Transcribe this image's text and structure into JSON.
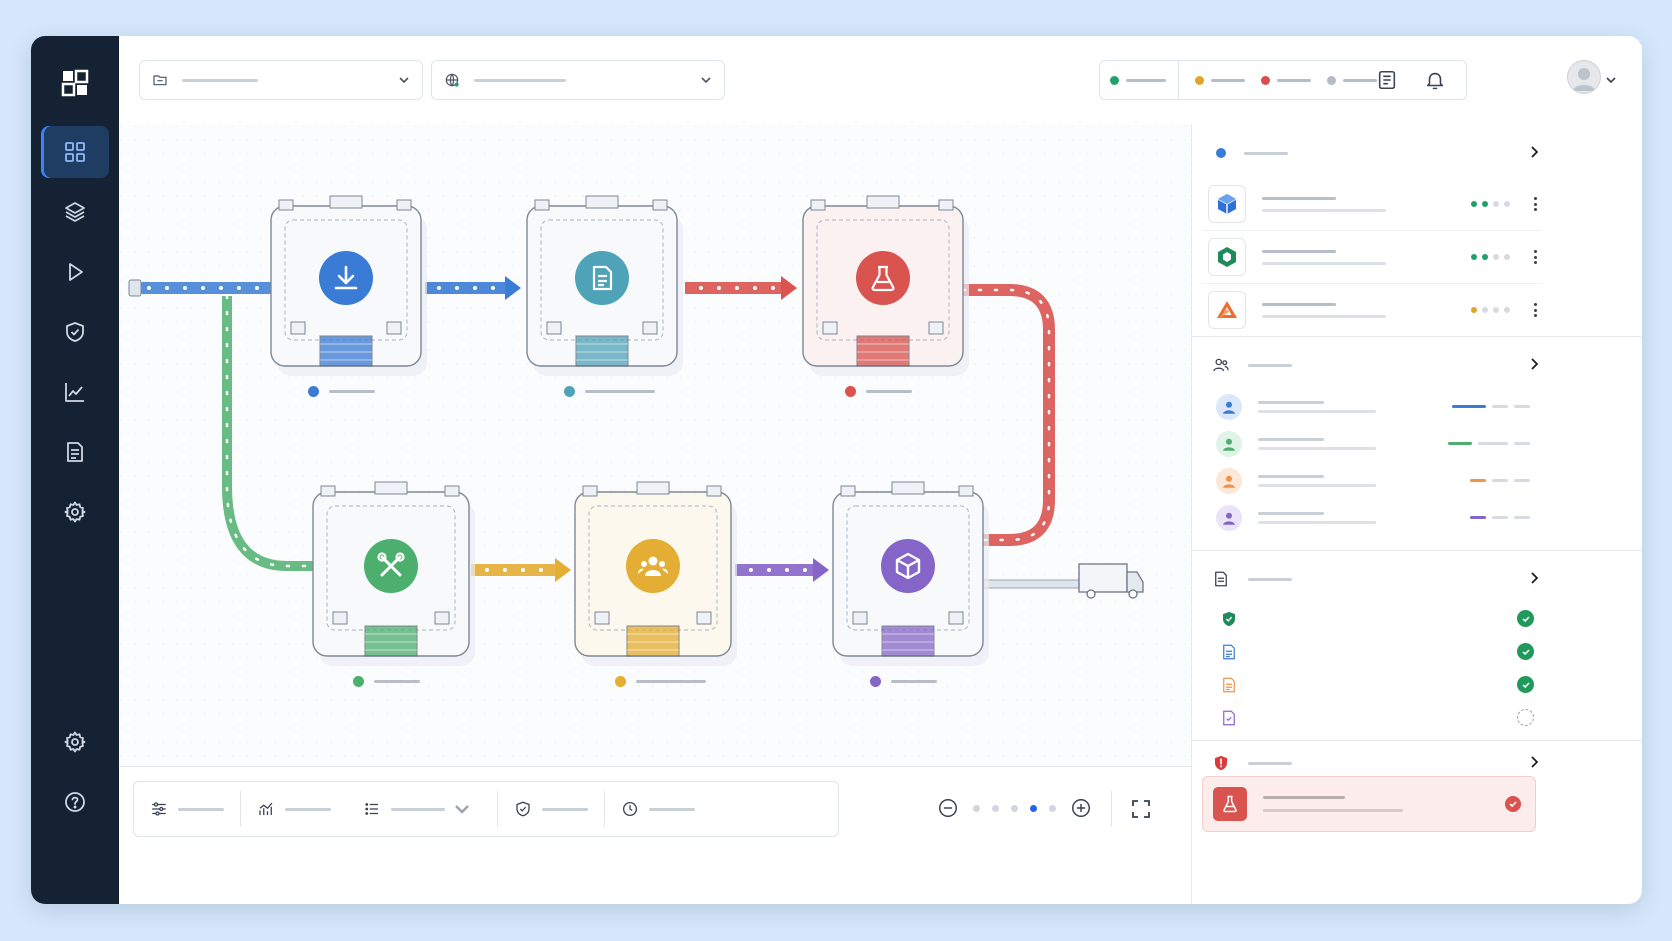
{
  "app": {
    "title": ""
  },
  "sidebar": {
    "items": [
      {
        "name": "dashboard",
        "icon": "grid-icon",
        "active": true
      },
      {
        "name": "layers",
        "icon": "layers-icon"
      },
      {
        "name": "play",
        "icon": "play-icon"
      },
      {
        "name": "shield",
        "icon": "shield-check-icon"
      },
      {
        "name": "analytics",
        "icon": "line-chart-icon"
      },
      {
        "name": "reports",
        "icon": "document-icon"
      },
      {
        "name": "settings",
        "icon": "gear-icon"
      }
    ],
    "bottom_items": [
      {
        "name": "settings",
        "icon": "gear-icon"
      },
      {
        "name": "help",
        "icon": "help-circle-icon"
      }
    ]
  },
  "topbar": {
    "project_dropdown": {
      "value": "",
      "icon": "folder-icon"
    },
    "region_dropdown": {
      "value": "",
      "icon": "globe-icon"
    },
    "status_legend": [
      {
        "label": "",
        "color": "#22a06b"
      },
      {
        "label": "",
        "color": "#e0a526"
      },
      {
        "label": "",
        "color": "#dc4c4c"
      },
      {
        "label": "",
        "color": "#b5bcc6"
      }
    ]
  },
  "pipeline": {
    "stations": [
      {
        "id": "ingest",
        "icon": "download-icon",
        "color": "#3a7bd5",
        "label": ""
      },
      {
        "id": "document",
        "icon": "document-icon",
        "color": "#4fa3b8",
        "label": ""
      },
      {
        "id": "lab",
        "icon": "flask-icon",
        "color": "#d9534f",
        "label": ""
      },
      {
        "id": "tools",
        "icon": "wrench-icon",
        "color": "#4caf6d",
        "label": ""
      },
      {
        "id": "team",
        "icon": "users-icon",
        "color": "#e4ad33",
        "label": ""
      },
      {
        "id": "package",
        "icon": "cube-icon",
        "color": "#8665c9",
        "label": ""
      }
    ]
  },
  "bottombar": {
    "tools": [
      {
        "name": "filters",
        "icon": "sliders-icon",
        "label": ""
      },
      {
        "name": "trends",
        "icon": "trend-icon",
        "label": ""
      },
      {
        "name": "list",
        "icon": "list-icon",
        "label": ""
      },
      {
        "name": "compliance",
        "icon": "shield-check-icon",
        "label": ""
      },
      {
        "name": "history",
        "icon": "clock-icon",
        "label": ""
      }
    ],
    "zoom_level_index": 4,
    "zoom_levels": 5
  },
  "right_panel": {
    "services_section": {
      "title": ""
    },
    "services": [
      {
        "icon": "blue-cube-icon",
        "name": "",
        "detail": "",
        "progress": 2
      },
      {
        "icon": "green-hex-icon",
        "name": "",
        "detail": "",
        "progress": 2
      },
      {
        "icon": "orange-a-icon",
        "name": "",
        "detail": "",
        "progress": 1
      }
    ],
    "team_section": {
      "title": ""
    },
    "team": [
      {
        "color": "#3a7bd5",
        "name": "",
        "role": ""
      },
      {
        "color": "#4caf6d",
        "name": "",
        "role": ""
      },
      {
        "color": "#f0924a",
        "name": "",
        "role": ""
      },
      {
        "color": "#8665c9",
        "name": "",
        "role": ""
      }
    ],
    "docs_section": {
      "title": ""
    },
    "docs": [
      {
        "icon": "shield-check-icon",
        "name": "",
        "done": true
      },
      {
        "icon": "document-icon",
        "name": "",
        "done": true
      },
      {
        "icon": "document-orange-icon",
        "name": "",
        "done": true
      },
      {
        "icon": "document-purple-icon",
        "name": "",
        "done": false
      }
    ],
    "alerts_section": {
      "title": ""
    },
    "alert": {
      "icon": "flask-icon",
      "title": "",
      "detail": ""
    }
  }
}
